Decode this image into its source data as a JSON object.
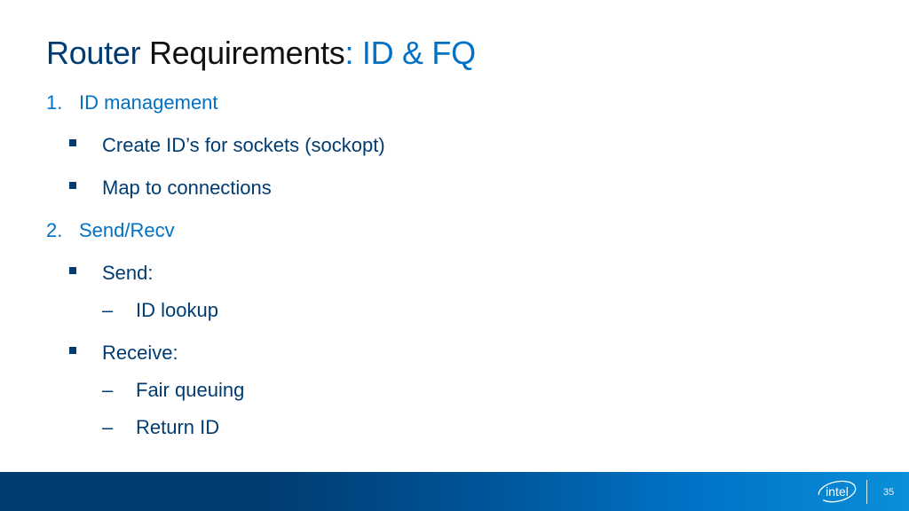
{
  "slide": {
    "title": {
      "part1": "Router",
      "part2": " Requirements",
      "part3": ": ID & FQ"
    },
    "sections": [
      {
        "number": "1.",
        "label": "ID management",
        "bullets": [
          {
            "label": "Create ID’s for sockets (sockopt)"
          },
          {
            "label": "Map to connections"
          }
        ]
      },
      {
        "number": "2.",
        "label": "Send/Recv",
        "bullets": [
          {
            "label": "Send:",
            "subitems": [
              {
                "dash": "–",
                "label": "ID lookup"
              }
            ]
          },
          {
            "label": "Receive:",
            "subitems": [
              {
                "dash": "–",
                "label": "Fair queuing"
              },
              {
                "dash": "–",
                "label": "Return ID"
              }
            ]
          }
        ]
      }
    ]
  },
  "footer": {
    "logo_icon": "intel-logo-icon",
    "logo_text": "intel",
    "page_number": "35",
    "colors": {
      "dark": "#003c71",
      "light": "#0a8fd8"
    }
  },
  "colors": {
    "title_dark": "#003c71",
    "accent": "#0071c5",
    "body": "#003c71"
  }
}
